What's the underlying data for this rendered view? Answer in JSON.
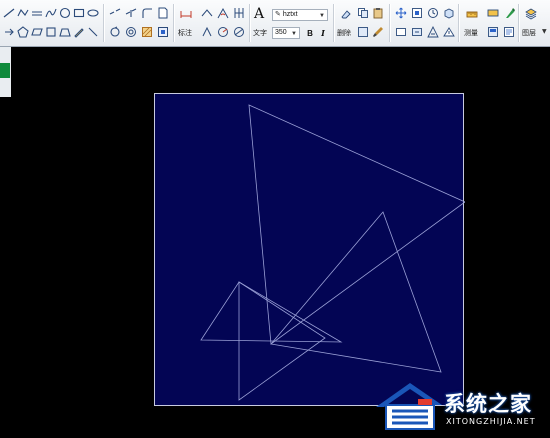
{
  "toolbar": {
    "annotate_label": "标注",
    "text_label": "文字",
    "text_style_value": "hztxt",
    "text_height_value": "350",
    "bold_label": "B",
    "italic_label": "I",
    "delete_label": "删除",
    "measure_label": "测量",
    "layer_label": "图层",
    "text_big_glyph": "A"
  },
  "watermark": {
    "name": "系统之家",
    "domain": "XITONGZHIJIA.NET"
  },
  "colors": {
    "canvas_background": "#030554",
    "line_color": "#9aa0d6",
    "accent_green": "#0f8a3c"
  }
}
